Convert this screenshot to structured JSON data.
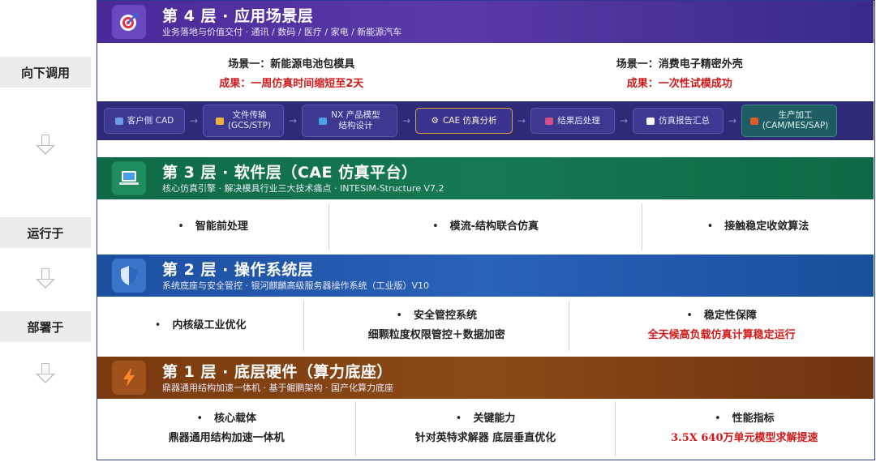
{
  "rail": {
    "call_down": "向下调用",
    "runs_on": "运行于",
    "deployed_on": "部署于"
  },
  "layer4": {
    "title": "第 4 层 · 应用场景层",
    "subtitle": "业务落地与价值交付 · 通讯 / 数码 / 医疗 / 家电 / 新能源汽车",
    "scenes": [
      {
        "title": "场景一：新能源电池包模具",
        "result": "成果：一周仿真时间缩短至2天"
      },
      {
        "title": "场景一：消费电子精密外壳",
        "result": "成果：一次性试模成功"
      }
    ]
  },
  "pipeline": {
    "steps": [
      {
        "label": "客户侧 CAD",
        "icon": "user-icon",
        "color": "#6a9ae8"
      },
      {
        "label": "文件传输\n(GCS/STP)",
        "icon": "folder-icon",
        "color": "#f0b43a"
      },
      {
        "label": "NX 产品模型\n结构设计",
        "icon": "monitor-icon",
        "color": "#4aa0e8"
      },
      {
        "label": "CAE 仿真分析",
        "icon": "gear-icon",
        "color": "#c9c9d9"
      },
      {
        "label": "结果后处理",
        "icon": "chart-icon",
        "color": "#d2508a"
      },
      {
        "label": "仿真报告汇总",
        "icon": "document-icon",
        "color": "#ffffff"
      },
      {
        "label": "生产加工\n(CAM/MES/SAP)",
        "icon": "factory-icon",
        "color": "#e05a2a"
      }
    ]
  },
  "layer3": {
    "title": "第 3 层 · 软件层（CAE 仿真平台）",
    "subtitle": "核心仿真引擎 · 解决模具行业三大技术痛点 · INTESIM-Structure V7.2",
    "items": [
      "智能前处理",
      "模流-结构联合仿真",
      "接触稳定收敛算法"
    ]
  },
  "layer2": {
    "title": "第 2 层 · 操作系统层",
    "subtitle": "系统底座与安全管控 · 银河麒麟高级服务器操作系统（工业版）V10",
    "items": [
      {
        "title": "内核级工业优化",
        "detail": ""
      },
      {
        "title": "安全管控系统",
        "detail": "细颗粒度权限管控＋数据加密"
      },
      {
        "title": "稳定性保障",
        "detail": "全天候高负载仿真计算稳定运行"
      }
    ]
  },
  "layer1": {
    "title": "第 1 层 · 底层硬件（算力底座）",
    "subtitle": "鼎器通用结构加速一体机 · 基于鲲鹏架构 · 国产化算力底座",
    "items": [
      {
        "title": "核心载体",
        "detail": "鼎器通用结构加速一体机"
      },
      {
        "title": "关键能力",
        "detail": "针对英特求解器 底层垂直优化"
      },
      {
        "title": "性能指标",
        "detail": "3.5X  640万单元模型求解提速"
      }
    ]
  },
  "colors": {
    "accent_red": "#d01a1a",
    "layer4": "#4a2a9a",
    "layer3": "#0f6b45",
    "layer2": "#1c4fa0",
    "layer1": "#7a3a0e"
  }
}
